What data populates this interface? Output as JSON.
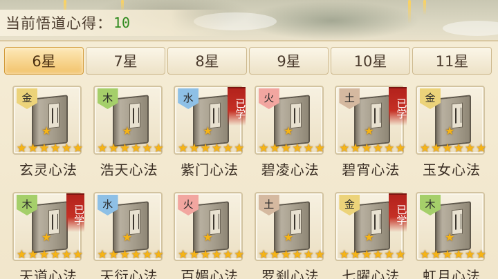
{
  "header": {
    "points_label": "当前悟道心得：",
    "points_value": "10"
  },
  "tabs": [
    {
      "label": "6星",
      "active": true
    },
    {
      "label": "7星",
      "active": false
    },
    {
      "label": "8星",
      "active": false
    },
    {
      "label": "9星",
      "active": false
    },
    {
      "label": "10星",
      "active": false
    },
    {
      "label": "11星",
      "active": false
    }
  ],
  "colors": {
    "gold_badge": "#ecd37a",
    "wood_badge": "#a5cf6a",
    "water_badge": "#8ec0e6",
    "fire_badge": "#f2a6a0",
    "earth_badge": "#d5b9a0",
    "learned_tag": "#c53025",
    "star": "#f6b416"
  },
  "book_icon": "manual-book-icon",
  "cards": [
    {
      "name": "玄灵心法",
      "element": "金",
      "element_type": "gold",
      "learned": false,
      "learned_label": "",
      "rating": 6,
      "rating_max": 6
    },
    {
      "name": "浩天心法",
      "element": "木",
      "element_type": "wood",
      "learned": false,
      "learned_label": "",
      "rating": 6,
      "rating_max": 6
    },
    {
      "name": "紫门心法",
      "element": "水",
      "element_type": "water",
      "learned": true,
      "learned_label": "已学",
      "rating": 6,
      "rating_max": 6
    },
    {
      "name": "碧凌心法",
      "element": "火",
      "element_type": "fire",
      "learned": false,
      "learned_label": "",
      "rating": 6,
      "rating_max": 6
    },
    {
      "name": "碧宵心法",
      "element": "土",
      "element_type": "earth",
      "learned": true,
      "learned_label": "已学",
      "rating": 6,
      "rating_max": 6
    },
    {
      "name": "玉女心法",
      "element": "金",
      "element_type": "gold",
      "learned": false,
      "learned_label": "",
      "rating": 6,
      "rating_max": 6
    },
    {
      "name": "天道心法",
      "element": "木",
      "element_type": "wood",
      "learned": true,
      "learned_label": "已学",
      "rating": 6,
      "rating_max": 6
    },
    {
      "name": "天衍心法",
      "element": "水",
      "element_type": "water",
      "learned": false,
      "learned_label": "",
      "rating": 6,
      "rating_max": 6
    },
    {
      "name": "百媚心法",
      "element": "火",
      "element_type": "fire",
      "learned": false,
      "learned_label": "",
      "rating": 6,
      "rating_max": 6
    },
    {
      "name": "罗刹心法",
      "element": "土",
      "element_type": "earth",
      "learned": false,
      "learned_label": "",
      "rating": 6,
      "rating_max": 6
    },
    {
      "name": "七曜心法",
      "element": "金",
      "element_type": "gold",
      "learned": true,
      "learned_label": "已学",
      "rating": 6,
      "rating_max": 6
    },
    {
      "name": "虹月心法",
      "element": "木",
      "element_type": "wood",
      "learned": false,
      "learned_label": "",
      "rating": 6,
      "rating_max": 6
    }
  ]
}
